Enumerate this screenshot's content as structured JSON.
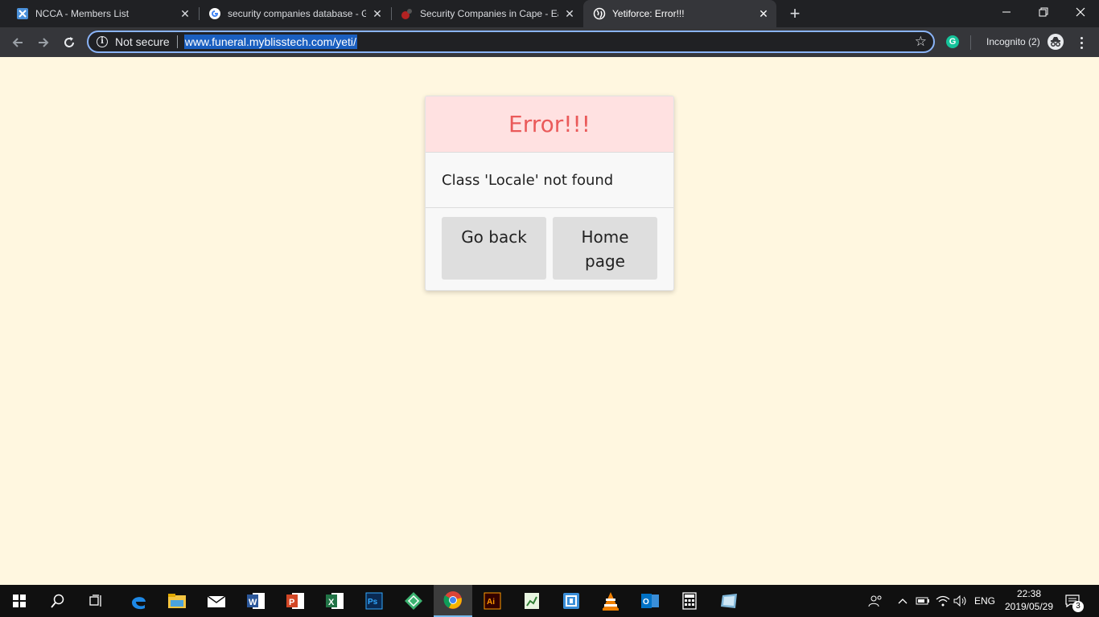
{
  "browser": {
    "tabs": [
      {
        "title": "NCCA - Members List",
        "favicon": "ncca-icon",
        "active": false
      },
      {
        "title": "security companies database - Go",
        "favicon": "google-icon",
        "active": false
      },
      {
        "title": "Security Companies in Cape - Ea",
        "favicon": "site-icon",
        "active": false
      },
      {
        "title": "Yetiforce: Error!!!",
        "favicon": "globe-icon",
        "active": true
      }
    ],
    "new_tab_label": "+",
    "security_label": "Not secure",
    "url": "www.funeral.myblisstech.com/yeti/",
    "incognito_label": "Incognito (2)",
    "extension_label": "G"
  },
  "page": {
    "error_title": "Error!!!",
    "error_message": "Class 'Locale' not found",
    "go_back_label": "Go back",
    "home_page_label": "Home page"
  },
  "taskbar": {
    "apps": [
      "start-icon",
      "search-icon",
      "task-view-icon",
      "edge-icon",
      "file-explorer-icon",
      "mail-icon",
      "word-icon",
      "powerpoint-icon",
      "excel-icon",
      "photoshop-icon",
      "app-green-icon",
      "chrome-icon",
      "illustrator-icon",
      "project-icon",
      "app-box-icon",
      "vlc-icon",
      "outlook-icon",
      "calculator-icon",
      "app-tile-icon"
    ],
    "active_app": "chrome-icon",
    "language": "ENG",
    "time": "22:38",
    "date": "2019/05/29",
    "notification_count": "3"
  },
  "colors": {
    "page_background": "#fff7e0",
    "error_header_bg": "#ffe1e1",
    "error_title": "#ea5a5a",
    "button_bg": "#dedede",
    "url_highlight": "#1a5fc0"
  }
}
